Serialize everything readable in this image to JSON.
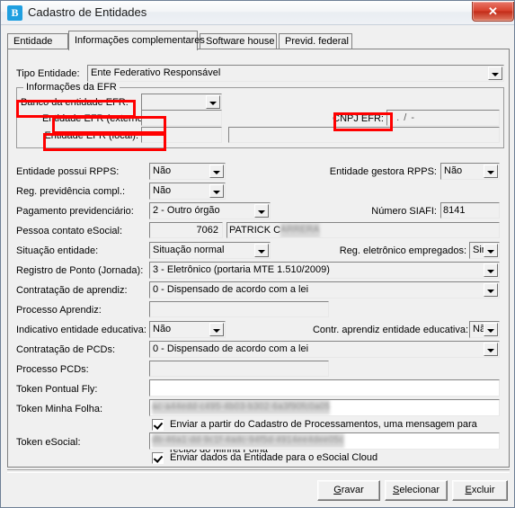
{
  "window": {
    "title": "Cadastro de Entidades",
    "icon": "B",
    "icon_name": "app-logo-icon",
    "close_label": "✕",
    "accent_blue": "#1f9fe0",
    "close_red": "#d8412c",
    "annotation_color": "#ff0000"
  },
  "tabs": [
    {
      "label": "Entidade",
      "active": false
    },
    {
      "label": "Informações complementares",
      "active": true
    },
    {
      "label": "Software house",
      "active": false
    },
    {
      "label": "Previd. federal",
      "active": false
    }
  ],
  "form": {
    "tipo_entidade": {
      "label": "Tipo Entidade:",
      "value": "Ente Federativo Responsável"
    },
    "efr_group": {
      "title": "Informações da EFR",
      "banco_label": "Banco da entidade EFR:",
      "banco_value": "",
      "externo_label": "Entidade EFR (externo):",
      "externo_value": "",
      "local_label": "Entidade EFR (local):",
      "local_code": "",
      "local_name": "",
      "cnpj_label": "CNPJ EFR:",
      "cnpj_value": ".    .    /      -"
    },
    "entidade_possui_rpps": {
      "label": "Entidade possui RPPS:",
      "value": "Não"
    },
    "entidade_gestora_rpps": {
      "label": "Entidade gestora RPPS:",
      "value": "Não"
    },
    "reg_previdencia_compl": {
      "label": "Reg. previdência compl.:",
      "value": "Não"
    },
    "pagamento_previdenciario": {
      "label": "Pagamento previdenciário:",
      "value": "2 - Outro órgão"
    },
    "numero_siafi": {
      "label": "Número SIAFI:",
      "value": "8141"
    },
    "pessoa_contato": {
      "label": "Pessoa contato eSocial:",
      "code": "7062",
      "name_visible": "PATRICK C",
      "name_redacted": "ARRERA"
    },
    "situacao_entidade": {
      "label": "Situação entidade:",
      "value": "Situação normal"
    },
    "reg_eletronico_empregados": {
      "label": "Reg. eletrônico empregados:",
      "value": "Sim"
    },
    "registro_ponto": {
      "label": "Registro de Ponto (Jornada):",
      "value": "3 - Eletrônico (portaria MTE 1.510/2009)"
    },
    "contratacao_aprendiz": {
      "label": "Contratação de aprendiz:",
      "value": "0 - Dispensado de acordo com a lei"
    },
    "processo_aprendiz": {
      "label": "Processo Aprendiz:",
      "value": ""
    },
    "indicativo_entidade_educativa": {
      "label": "Indicativo entidade educativa:",
      "value": "Não"
    },
    "contr_aprendiz_entidade_educativa": {
      "label": "Contr. aprendiz entidade educativa:",
      "value": "Não"
    },
    "contratacao_pcds": {
      "label": "Contratação de PCDs:",
      "value": "0 - Dispensado de acordo com a lei"
    },
    "processo_pcds": {
      "label": "Processo PCDs:",
      "value": ""
    },
    "token_pontual_fly": {
      "label": "Token Pontual Fly:",
      "value": ""
    },
    "token_minha_folha": {
      "label": "Token Minha Folha:",
      "value_redacted": "ac-a44edd-c495-4b03-b302-6a3f90fc0a05"
    },
    "checkbox_minha_folha": {
      "line1": "Enviar a partir do Cadastro de Processamentos, uma mensagem para o",
      "line2": "recibo do Minha Folha",
      "checked": true
    },
    "token_esocial": {
      "label": "Token eSocial:",
      "value_redacted": "db-46a1-dd-9c1f-4adc-94f5d-4914ee4dee05c"
    },
    "checkbox_esocial": {
      "label": "Enviar dados da Entidade para o eSocial Cloud",
      "checked": true
    }
  },
  "buttons": {
    "gravar": {
      "accel": "G",
      "rest": "ravar"
    },
    "selecionar": {
      "accel": "S",
      "rest": "elecionar"
    },
    "excluir": {
      "accel": "E",
      "rest": "xcluir"
    }
  },
  "annotations": [
    {
      "name": "banco-da-entidade-efr",
      "target": "Banco da entidade EFR:"
    },
    {
      "name": "entidade-efr-externo",
      "target": "Entidade EFR (externo):"
    },
    {
      "name": "entidade-efr-local",
      "target": "Entidade EFR (local):"
    },
    {
      "name": "cnpj-efr",
      "target": "CNPJ EFR:"
    }
  ]
}
